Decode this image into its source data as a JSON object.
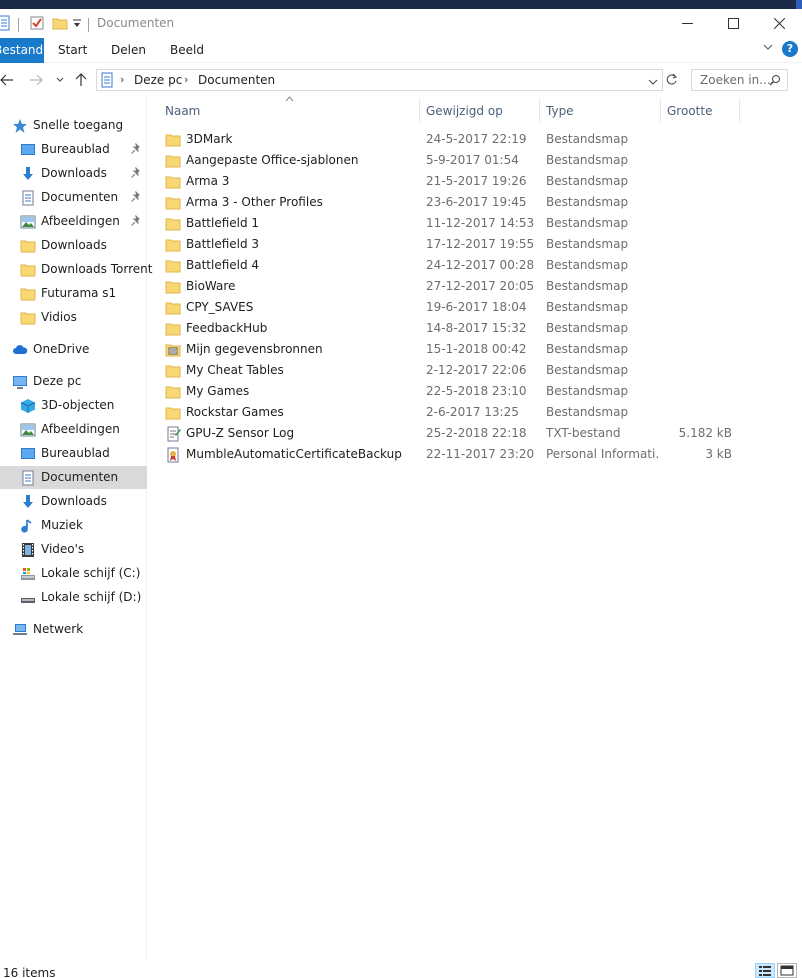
{
  "window": {
    "title": "Documenten",
    "controls": {
      "minimize": "─",
      "maximize": "☐",
      "close": "✕"
    }
  },
  "ribbon": {
    "tabs": [
      {
        "label": "Bestand"
      },
      {
        "label": "Start"
      },
      {
        "label": "Delen"
      },
      {
        "label": "Beeld"
      }
    ],
    "expand_glyph": "˅",
    "help_glyph": "?"
  },
  "address": {
    "breadcrumbs": [
      "Deze pc",
      "Documenten"
    ],
    "search_placeholder": "Zoeken in..."
  },
  "navigation": {
    "quick_access": {
      "label": "Snelle toegang",
      "items": [
        {
          "label": "Bureaublad",
          "icon": "desktop-icon",
          "pinned": true
        },
        {
          "label": "Downloads",
          "icon": "download-icon",
          "pinned": true
        },
        {
          "label": "Documenten",
          "icon": "document-icon",
          "pinned": true
        },
        {
          "label": "Afbeeldingen",
          "icon": "pictures-icon",
          "pinned": true
        },
        {
          "label": "Downloads",
          "icon": "folder-icon",
          "pinned": false
        },
        {
          "label": "Downloads Torrent",
          "icon": "folder-icon",
          "pinned": false
        },
        {
          "label": "Futurama s1",
          "icon": "folder-icon",
          "pinned": false
        },
        {
          "label": "Vidios",
          "icon": "folder-icon",
          "pinned": false
        }
      ]
    },
    "onedrive": {
      "label": "OneDrive"
    },
    "this_pc": {
      "label": "Deze pc",
      "items": [
        {
          "label": "3D-objecten",
          "icon": "cube-icon"
        },
        {
          "label": "Afbeeldingen",
          "icon": "pictures-icon"
        },
        {
          "label": "Bureaublad",
          "icon": "desktop-icon"
        },
        {
          "label": "Documenten",
          "icon": "document-icon",
          "selected": true
        },
        {
          "label": "Downloads",
          "icon": "download-icon"
        },
        {
          "label": "Muziek",
          "icon": "music-icon"
        },
        {
          "label": "Video's",
          "icon": "video-icon"
        },
        {
          "label": "Lokale schijf (C:)",
          "icon": "system-drive-icon"
        },
        {
          "label": "Lokale schijf (D:)",
          "icon": "drive-icon"
        }
      ]
    },
    "network": {
      "label": "Netwerk"
    }
  },
  "list": {
    "columns": {
      "name": "Naam",
      "modified": "Gewijzigd op",
      "type": "Type",
      "size": "Grootte"
    },
    "rows": [
      {
        "name": "3DMark",
        "modified": "24-5-2017 22:19",
        "type": "Bestandsmap",
        "size": "",
        "icon": "folder-icon"
      },
      {
        "name": "Aangepaste Office-sjablonen",
        "modified": "5-9-2017 01:54",
        "type": "Bestandsmap",
        "size": "",
        "icon": "folder-icon"
      },
      {
        "name": "Arma 3",
        "modified": "21-5-2017 19:26",
        "type": "Bestandsmap",
        "size": "",
        "icon": "folder-icon"
      },
      {
        "name": "Arma 3 - Other Profiles",
        "modified": "23-6-2017 19:45",
        "type": "Bestandsmap",
        "size": "",
        "icon": "folder-icon"
      },
      {
        "name": "Battlefield 1",
        "modified": "11-12-2017 14:53",
        "type": "Bestandsmap",
        "size": "",
        "icon": "folder-icon"
      },
      {
        "name": "Battlefield 3",
        "modified": "17-12-2017 19:55",
        "type": "Bestandsmap",
        "size": "",
        "icon": "folder-icon"
      },
      {
        "name": "Battlefield 4",
        "modified": "24-12-2017 00:28",
        "type": "Bestandsmap",
        "size": "",
        "icon": "folder-icon"
      },
      {
        "name": "BioWare",
        "modified": "27-12-2017 20:05",
        "type": "Bestandsmap",
        "size": "",
        "icon": "folder-icon"
      },
      {
        "name": "CPY_SAVES",
        "modified": "19-6-2017 18:04",
        "type": "Bestandsmap",
        "size": "",
        "icon": "folder-icon"
      },
      {
        "name": "FeedbackHub",
        "modified": "14-8-2017 15:32",
        "type": "Bestandsmap",
        "size": "",
        "icon": "folder-icon"
      },
      {
        "name": "Mijn gegevensbronnen",
        "modified": "15-1-2018 00:42",
        "type": "Bestandsmap",
        "size": "",
        "icon": "datasource-folder-icon"
      },
      {
        "name": "My Cheat Tables",
        "modified": "2-12-2017 22:06",
        "type": "Bestandsmap",
        "size": "",
        "icon": "folder-icon"
      },
      {
        "name": "My Games",
        "modified": "22-5-2018 23:10",
        "type": "Bestandsmap",
        "size": "",
        "icon": "folder-icon"
      },
      {
        "name": "Rockstar Games",
        "modified": "2-6-2017 13:25",
        "type": "Bestandsmap",
        "size": "",
        "icon": "folder-icon"
      },
      {
        "name": "GPU-Z Sensor Log",
        "modified": "25-2-2018 22:18",
        "type": "TXT-bestand",
        "size": "5.182 kB",
        "icon": "text-file-icon"
      },
      {
        "name": "MumbleAutomaticCertificateBackup",
        "modified": "22-11-2017 23:20",
        "type": "Personal Informati...",
        "size": "3 kB",
        "icon": "certificate-file-icon"
      }
    ]
  },
  "status": {
    "item_count": "16 items"
  },
  "colors": {
    "accent": "#1979ca",
    "folder": "#f8d775",
    "folder_dark": "#e3b549",
    "selected": "#d9d9d9"
  }
}
